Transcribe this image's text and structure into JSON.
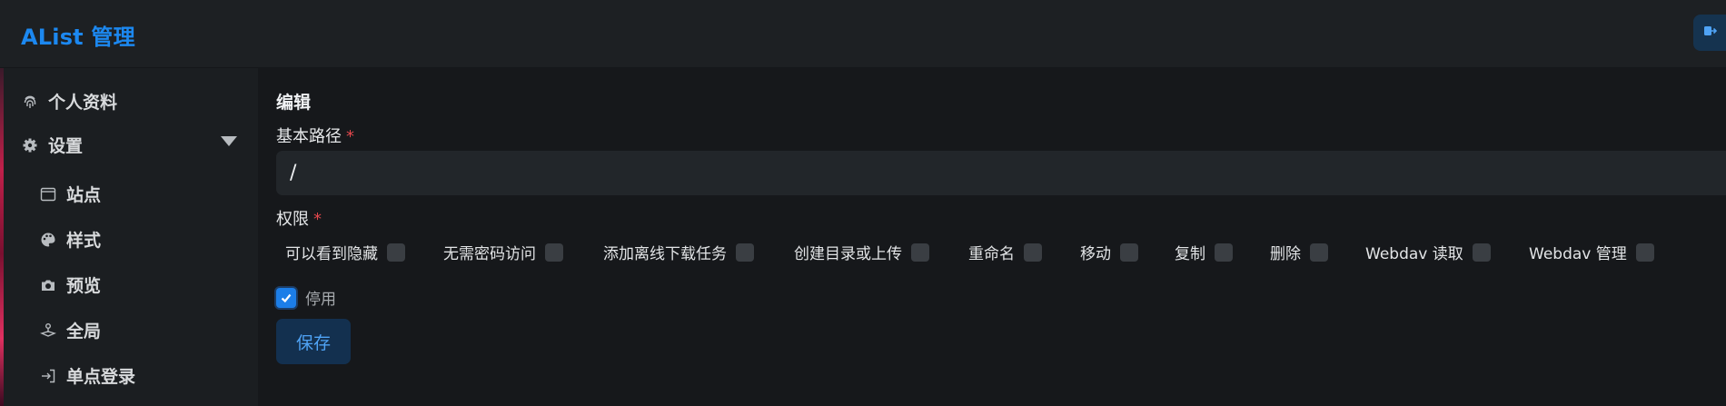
{
  "header": {
    "logo": "AList 管理",
    "logout_icon": "logout-icon"
  },
  "sidebar": {
    "items": [
      {
        "label": "个人资料",
        "icon": "fingerprint-icon"
      },
      {
        "label": "设置",
        "icon": "gear-icon",
        "expanded": true
      },
      {
        "label": "站点",
        "icon": "window-icon"
      },
      {
        "label": "样式",
        "icon": "palette-icon"
      },
      {
        "label": "预览",
        "icon": "camera-icon"
      },
      {
        "label": "全局",
        "icon": "joystick-icon"
      },
      {
        "label": "单点登录",
        "icon": "login-icon"
      }
    ]
  },
  "form": {
    "title": "编辑",
    "base_path_label": "基本路径",
    "required_mark": "*",
    "base_path_value": "/",
    "permissions_label": "权限",
    "permissions": [
      {
        "label": "可以看到隐藏",
        "checked": false
      },
      {
        "label": "无需密码访问",
        "checked": false
      },
      {
        "label": "添加离线下载任务",
        "checked": false
      },
      {
        "label": "创建目录或上传",
        "checked": false
      },
      {
        "label": "重命名",
        "checked": false
      },
      {
        "label": "移动",
        "checked": false
      },
      {
        "label": "复制",
        "checked": false
      },
      {
        "label": "删除",
        "checked": false
      },
      {
        "label": "Webdav 读取",
        "checked": false
      },
      {
        "label": "Webdav 管理",
        "checked": false
      }
    ],
    "disabled_label": "停用",
    "disabled_checked": true,
    "save_label": "保存"
  },
  "colors": {
    "accent": "#1c88f0",
    "required": "#e5484d",
    "background": "#16181b",
    "sidebar": "#1b1e21"
  }
}
